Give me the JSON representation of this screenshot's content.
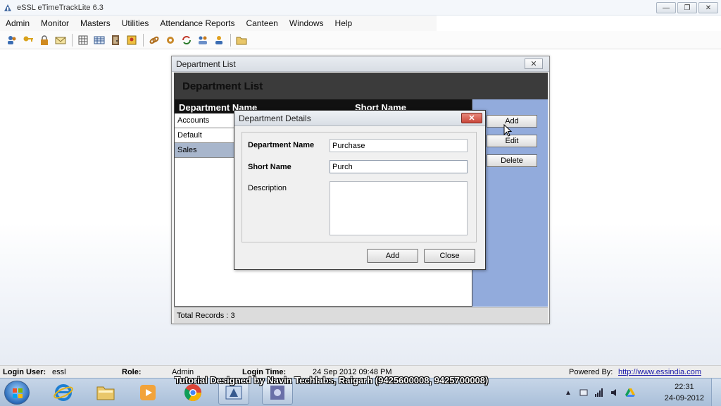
{
  "window": {
    "title": "eSSL eTimeTrackLite 6.3",
    "controls": [
      "minimize",
      "restore",
      "close"
    ]
  },
  "menu": [
    "Admin",
    "Monitor",
    "Masters",
    "Utilities",
    "Attendance Reports",
    "Canteen",
    "Windows",
    "Help"
  ],
  "toolbar_icons": [
    "users-icon",
    "key-icon",
    "lock-icon",
    "mail-icon",
    "grid-icon",
    "table-icon",
    "door-icon",
    "badge-icon",
    "link-icon",
    "settings-icon",
    "sync-icon",
    "people-icon",
    "group-icon",
    "folder-icon"
  ],
  "department_list": {
    "caption": "Department List",
    "header": "Department List",
    "columns": [
      "Department Name",
      "Short Name"
    ],
    "rows": [
      "Accounts",
      "Default",
      "Sales"
    ],
    "selected_row": "Sales",
    "buttons": {
      "add": "Add",
      "edit": "Edit",
      "delete": "Delete"
    },
    "status_label": "Total Records :",
    "status_count": "3"
  },
  "department_details": {
    "caption": "Department Details",
    "close_glyph": "✕",
    "name_label": "Department Name",
    "name_value": "Purchase",
    "short_label": "Short Name",
    "short_value": "Purch",
    "desc_label": "Description",
    "desc_value": "",
    "add_button": "Add",
    "close_button": "Close"
  },
  "statusbar": {
    "login_user_label": "Login User:",
    "login_user_value": "essl",
    "role_label": "Role:",
    "role_value": "Admin",
    "login_time_label": "Login Time:",
    "login_time_value": "24 Sep 2012 09:48 PM",
    "powered_label": "Powered By:",
    "powered_link": "http://www.essindia.com"
  },
  "watermark": "Tutorial Designed by Navin Techlabs, Raigarh (9425600008, 9425700008)",
  "taskbar": {
    "apps": [
      "internet-explorer-icon",
      "file-explorer-icon",
      "media-player-icon",
      "chrome-icon",
      "etimetrack-icon",
      "network-icon"
    ],
    "active_app_index": 4,
    "time": "22:31",
    "date": "24-09-2012"
  }
}
